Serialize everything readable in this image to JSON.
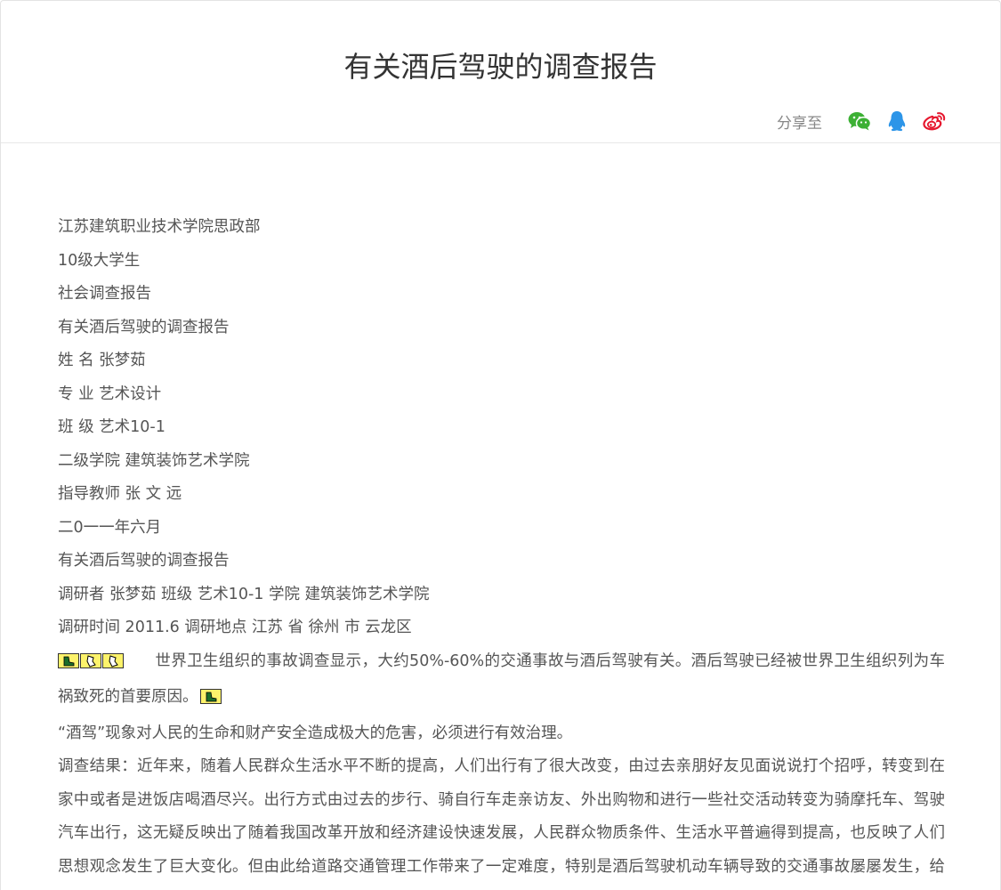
{
  "article": {
    "title": "有关酒后驾驶的调查报告"
  },
  "share": {
    "label": "分享至",
    "icons": [
      "wechat-icon",
      "qq-icon",
      "weibo-icon"
    ],
    "colors": {
      "wechat": "#3cb034",
      "qq": "#2d95e8",
      "weibo": "#e6162d"
    }
  },
  "content": {
    "lines": [
      "江苏建筑职业技术学院思政部",
      "10级大学生",
      "社会调查报告",
      "有关酒后驾驶的调查报告",
      "姓 名 张梦茹",
      "专 业 艺术设计",
      "班 级 艺术10-1",
      "二级学院 建筑装饰艺术学院",
      "指导教师 张 文 远",
      "二0一一年六月",
      "有关酒后驾驶的调查报告",
      "调研者 张梦茹 班级 艺术10-1 学院 建筑装饰艺术学院",
      "调研时间 2011.6 调研地点 江苏 省 徐州 市 云龙区"
    ],
    "para1": "世界卫生组织的事故调查显示，大约50%-60%的交通事故与酒后驾驶有关。酒后驾驶已经被世界卫生组织列为车祸致死的首要原因。",
    "para2": "“酒驾”现象对人民的生命和财产安全造成极大的危害，必须进行有效治理。",
    "para3": "调查结果：近年来，随着人民群众生活水平不断的提高，人们出行有了很大改变，由过去亲朋好友见面说说打个招呼，转变到在家中或者是进饭店喝酒尽兴。出行方式由过去的步行、骑自行车走亲访友、外出购物和进行一些社交活动转变为骑摩托车、驾驶汽车出行，这无疑反映出了随着我国改革开放和经济建设快速发展，人民群众物质条件、生活水平普遍得到提高，也反映了人们思想观念发生了巨大变化。但由此给道路交通管理工作带来了一定难度，特别是酒后驾驶机动车辆导致的交通事故屡屡发生，给广大人民群众的财产和生命安全造成了严重的损失。"
  }
}
